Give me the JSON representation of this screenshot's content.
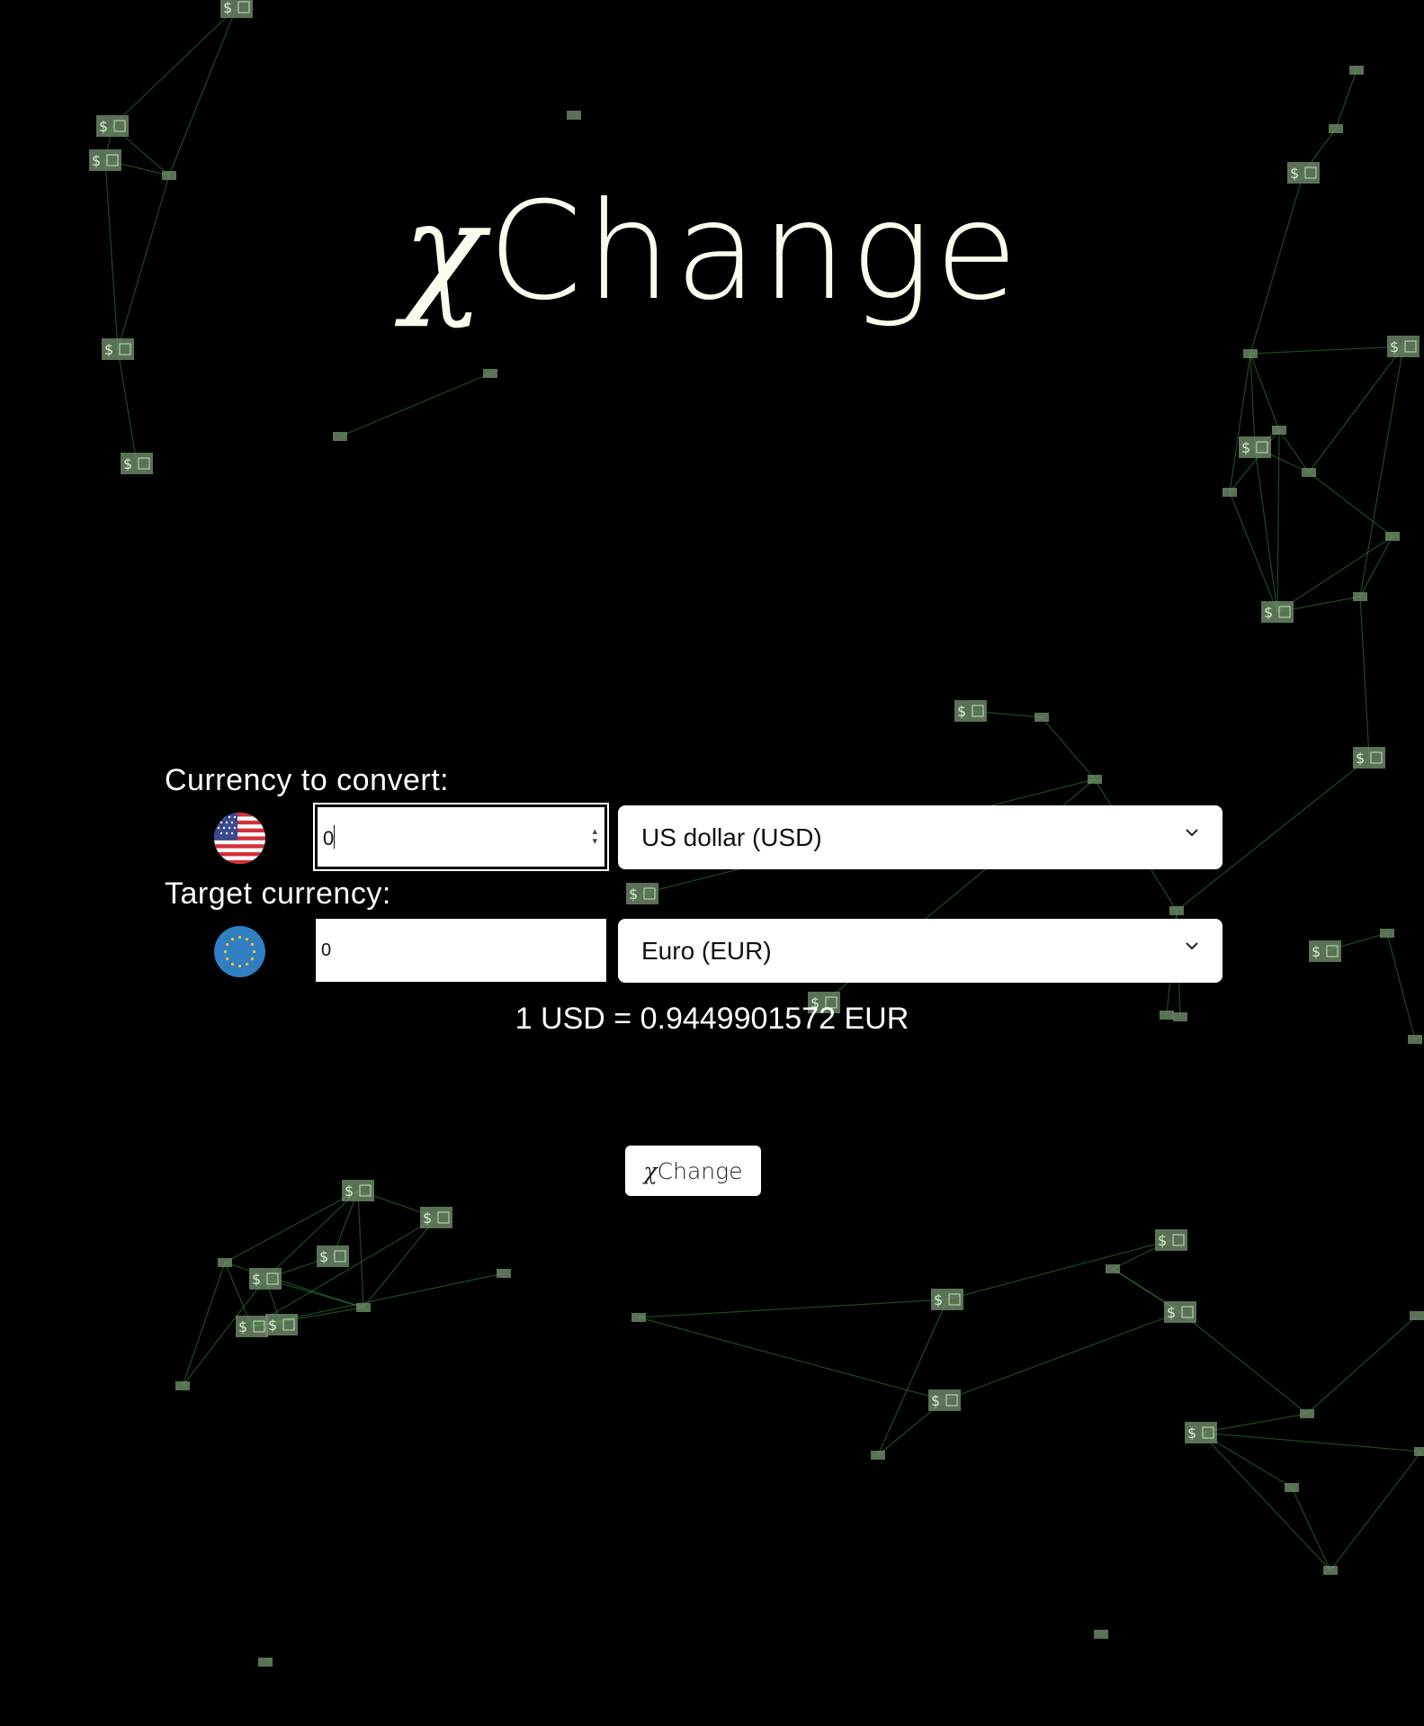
{
  "logo": {
    "chi": "χ",
    "rest": "Change"
  },
  "converter": {
    "source_label": "Currency to convert:",
    "source_value": "0",
    "source_currency": "US dollar (USD)",
    "target_label": "Target currency:",
    "target_value": "0",
    "target_currency": "Euro (EUR)",
    "rate_text": "1 USD = 0.9449901572 EUR"
  },
  "button": {
    "chi": "χ",
    "rest": "Change"
  },
  "icons": {
    "source_flag": "us-flag-icon",
    "target_flag": "eu-flag-icon",
    "dropdown": "chevron-down-icon",
    "background_node": "dollar-bill-icon"
  },
  "colors": {
    "background": "#000000",
    "logo": "#fbfbee",
    "network_line": "#2e8b3a",
    "bill": "#6f8f6a"
  }
}
